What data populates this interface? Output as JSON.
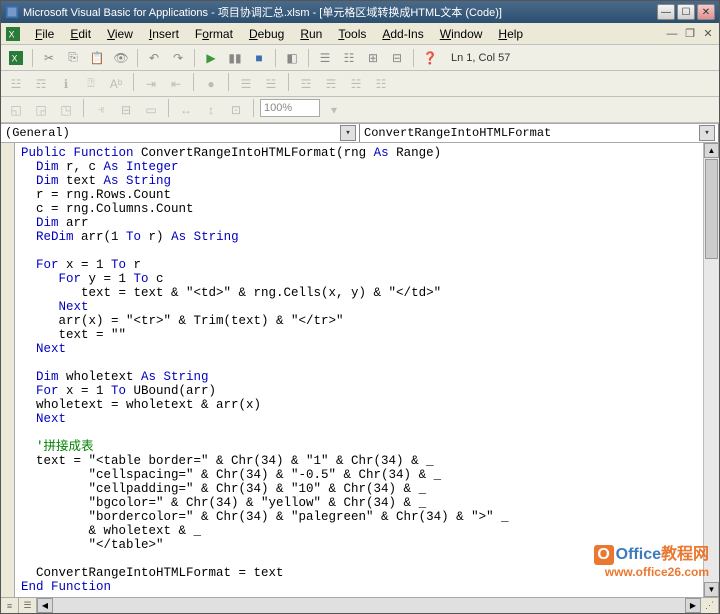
{
  "title": "Microsoft Visual Basic for Applications - 项目协调汇总.xlsm - [单元格区域转换成HTML文本 (Code)]",
  "menu": {
    "file": "File",
    "edit": "Edit",
    "view": "View",
    "insert": "Insert",
    "format": "Format",
    "debug": "Debug",
    "run": "Run",
    "tools": "Tools",
    "addins": "Add-Ins",
    "window": "Window",
    "help": "Help"
  },
  "status": {
    "cursor": "Ln 1, Col 57"
  },
  "zoom": "100%",
  "combo": {
    "left": "(General)",
    "right": "ConvertRangeIntoHTMLFormat"
  },
  "code": {
    "l1a": "Public Function",
    "l1b": " ConvertRangeIntoHTMLFormat(rng ",
    "l1c": "As",
    "l1d": " Range)",
    "l2a": "  Dim",
    "l2b": " r, c ",
    "l2c": "As Integer",
    "l3a": "  Dim",
    "l3b": " text ",
    "l3c": "As String",
    "l4": "  r = rng.Rows.Count",
    "l5": "  c = rng.Columns.Count",
    "l6a": "  Dim",
    "l6b": " arr",
    "l7a": "  ReDim",
    "l7b": " arr(1 ",
    "l7c": "To",
    "l7d": " r) ",
    "l7e": "As String",
    "blank": "",
    "l8a": "  For",
    "l8b": " x = 1 ",
    "l8c": "To",
    "l8d": " r",
    "l9a": "     For",
    "l9b": " y = 1 ",
    "l9c": "To",
    "l9d": " c",
    "l10": "        text = text & \"<td>\" & rng.Cells(x, y) & \"</td>\"",
    "l11": "     Next",
    "l12": "     arr(x) = \"<tr>\" & Trim(text) & \"</tr>\"",
    "l13": "     text = \"\"",
    "l14": "  Next",
    "l15a": "  Dim",
    "l15b": " wholetext ",
    "l15c": "As String",
    "l16a": "  For",
    "l16b": " x = 1 ",
    "l16c": "To",
    "l16d": " UBound(arr)",
    "l17": "  wholetext = wholetext & arr(x)",
    "l18": "  Next",
    "cmt": "  '拼接成表",
    "l19": "  text = \"<table border=\" & Chr(34) & \"1\" & Chr(34) & _",
    "l20": "         \"cellspacing=\" & Chr(34) & \"-0.5\" & Chr(34) & _",
    "l21": "         \"cellpadding=\" & Chr(34) & \"10\" & Chr(34) & _",
    "l22": "         \"bgcolor=\" & Chr(34) & \"yellow\" & Chr(34) & _",
    "l23": "         \"bordercolor=\" & Chr(34) & \"palegreen\" & Chr(34) & \">\" _",
    "l24": "         & wholetext & _",
    "l25": "         \"</table>\"",
    "l26": "  ConvertRangeIntoHTMLFormat = text",
    "l27": "End Function"
  },
  "watermark": {
    "brand1": "Office",
    "brand2": "教程网",
    "site": "www.office26.com"
  }
}
